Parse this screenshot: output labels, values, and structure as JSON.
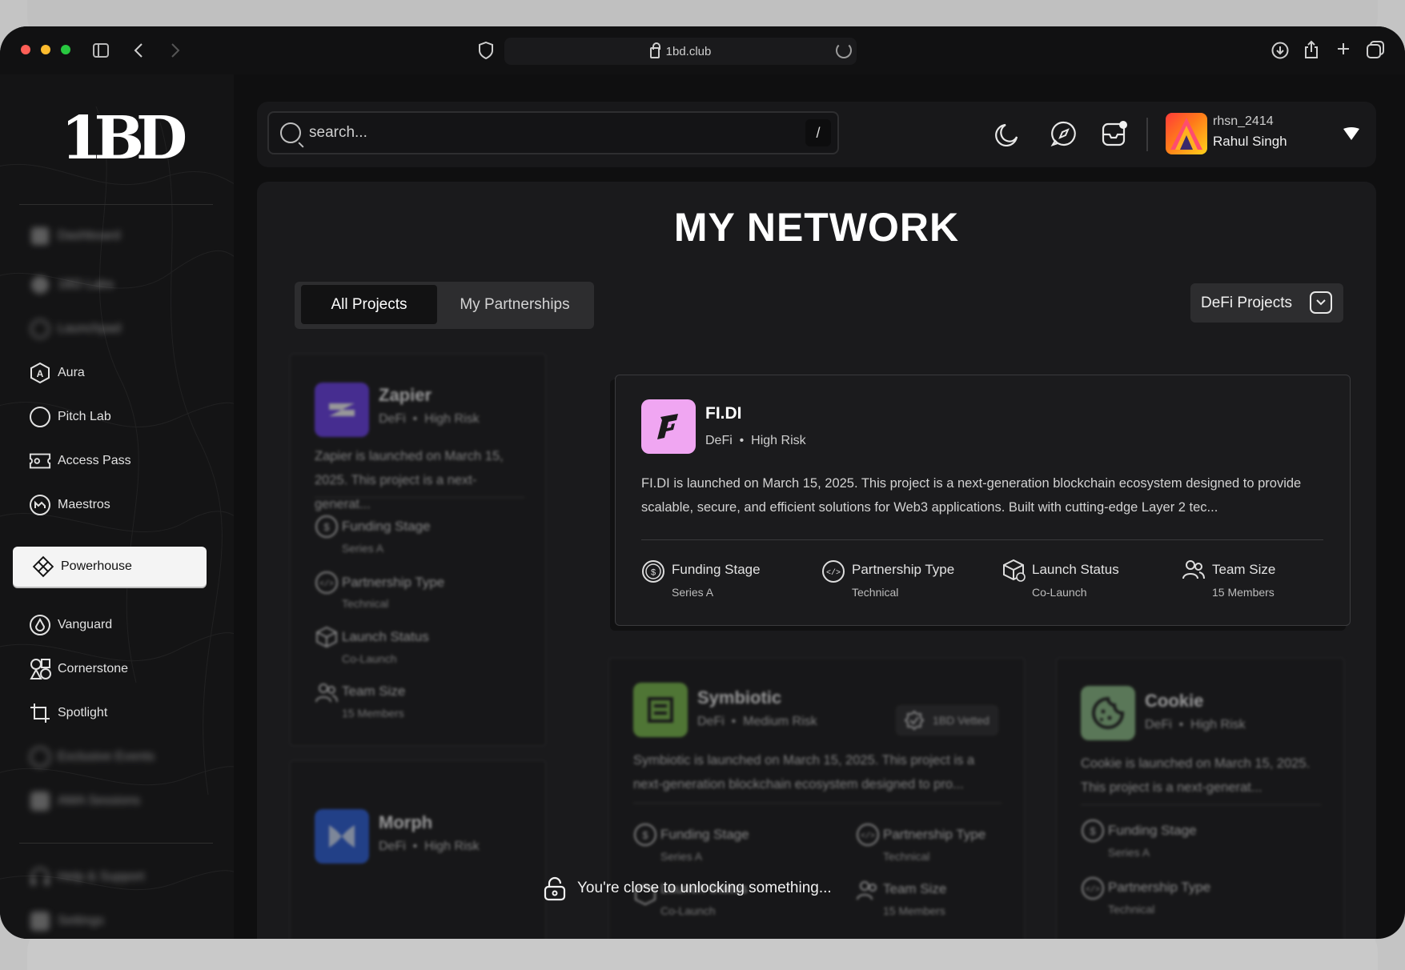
{
  "browser": {
    "url": "1bd.club",
    "traffic_colors": [
      "#ff5f57",
      "#febc2e",
      "#28c840"
    ]
  },
  "sidebar": {
    "logo": "1BD",
    "items": [
      {
        "label": "Dashboard",
        "icon": "dashboard-icon",
        "blurred": true
      },
      {
        "label": "1BD Labs",
        "icon": "labs-icon",
        "blurred": true
      },
      {
        "label": "Launchpad",
        "icon": "launchpad-icon",
        "blurred": true
      },
      {
        "label": "Aura",
        "icon": "aura-icon",
        "blurred": false
      },
      {
        "label": "Pitch Lab",
        "icon": "circle-icon",
        "blurred": false
      },
      {
        "label": "Access Pass",
        "icon": "ticket-icon",
        "blurred": false
      },
      {
        "label": "Maestros",
        "icon": "maestros-icon",
        "blurred": false
      },
      {
        "label": "Powerhouse",
        "icon": "diamond-icon",
        "blurred": false,
        "active": true
      },
      {
        "label": "Vanguard",
        "icon": "drop-icon",
        "blurred": false
      },
      {
        "label": "Cornerstone",
        "icon": "shapes-icon",
        "blurred": false
      },
      {
        "label": "Spotlight",
        "icon": "crop-icon",
        "blurred": false
      },
      {
        "label": "Exclusive Events",
        "icon": "event-icon",
        "blurred": true
      },
      {
        "label": "AMA Sessions",
        "icon": "ama-icon",
        "blurred": true
      },
      {
        "label": "Help & Support",
        "icon": "headset-icon",
        "blurred": true
      },
      {
        "label": "Settings",
        "icon": "settings-icon",
        "blurred": true
      }
    ]
  },
  "topbar": {
    "search_placeholder": "search...",
    "search_shortcut": "/",
    "user_handle": "rhsn_2414",
    "user_name": "Rahul Singh"
  },
  "main": {
    "title": "MY NETWORK",
    "tabs": [
      "All Projects",
      "My Partnerships"
    ],
    "filter_label": "DeFi Projects"
  },
  "cards": {
    "zapier": {
      "name": "Zapier",
      "category": "DeFi",
      "risk": "High Risk",
      "desc": "Zapier is launched on March 15, 2025. This project is a next-generat...",
      "stats": [
        {
          "label": "Funding Stage",
          "value": "Series A"
        },
        {
          "label": "Partnership Type",
          "value": "Technical"
        },
        {
          "label": "Launch Status",
          "value": "Co-Launch"
        },
        {
          "label": "Team Size",
          "value": "15 Members"
        }
      ]
    },
    "fidi": {
      "name": "FI.DI",
      "category": "DeFi",
      "risk": "High Risk",
      "desc": "FI.DI is launched on March 15, 2025. This project is a next-generation blockchain ecosystem designed to provide scalable, secure, and efficient solutions for Web3 applications. Built with cutting-edge Layer 2 tec...",
      "stats": [
        {
          "label": "Funding Stage",
          "value": "Series A"
        },
        {
          "label": "Partnership Type",
          "value": "Technical"
        },
        {
          "label": "Launch Status",
          "value": "Co-Launch"
        },
        {
          "label": "Team Size",
          "value": "15 Members"
        }
      ]
    },
    "symbiotic": {
      "name": "Symbiotic",
      "category": "DeFi",
      "risk": "Medium Risk",
      "badge": "1BD Vetted",
      "desc": "Symbiotic is launched on March 15, 2025. This project is a next-generation blockchain ecosystem designed to pro...",
      "stats": [
        {
          "label": "Funding Stage",
          "value": "Series A"
        },
        {
          "label": "Partnership Type",
          "value": "Technical"
        },
        {
          "label": "Launch Status",
          "value": "Co-Launch"
        },
        {
          "label": "Team Size",
          "value": "15 Members"
        }
      ]
    },
    "cookie": {
      "name": "Cookie",
      "category": "DeFi",
      "risk": "High Risk",
      "desc": "Cookie is launched on March 15, 2025. This project is a next-generat...",
      "stats": [
        {
          "label": "Funding Stage",
          "value": "Series A"
        },
        {
          "label": "Partnership Type",
          "value": "Technical"
        }
      ]
    },
    "morph": {
      "name": "Morph",
      "category": "DeFi",
      "risk": "High Risk"
    }
  },
  "toast": "You're close to unlocking something...",
  "colors": {
    "zapier_logo": "#6a3df0",
    "fidi_logo": "#f0a6f2",
    "symbiotic_logo": "#7bc04a",
    "cookie_logo": "#8fc48a",
    "morph_logo": "#2a5fe0"
  }
}
